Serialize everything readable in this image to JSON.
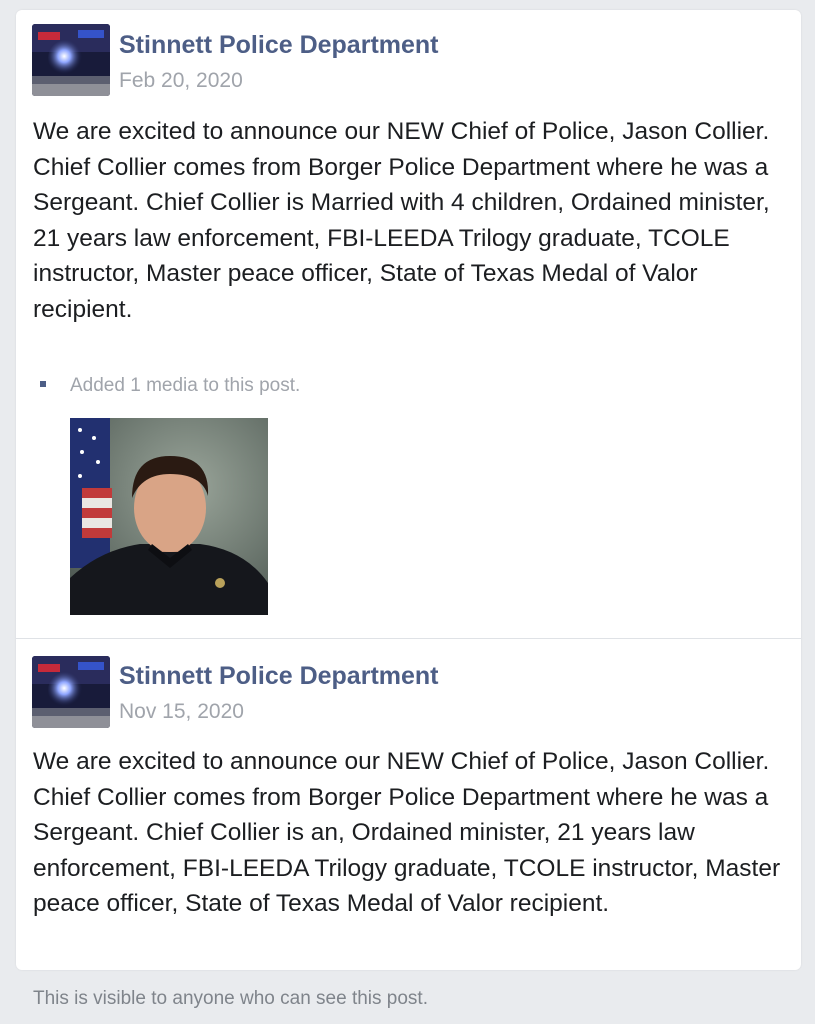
{
  "posts": [
    {
      "page_name": "Stinnett Police Department",
      "date": "Feb 20, 2020",
      "body": "We are excited to announce our NEW Chief of Police, Jason Collier. Chief Collier comes from Borger Police Department where he was a Sergeant. Chief Collier is Married with 4 children, Ordained minister, 21 years law enforcement, FBI-LEEDA Trilogy graduate, TCOLE instructor, Master peace officer, State of Texas Medal of Valor recipient.",
      "media_note": "Added 1 media to this post."
    },
    {
      "page_name": "Stinnett Police Department",
      "date": "Nov 15, 2020",
      "body": "We are excited to announce our NEW Chief of Police, Jason Collier. Chief Collier comes from Borger Police Department where he was a Sergeant. Chief Collier is an, Ordained minister, 21 years law enforcement, FBI-LEEDA Trilogy graduate, TCOLE instructor, Master peace officer, State of Texas Medal of Valor recipient."
    }
  ],
  "footer": {
    "visibility_note": "This is visible to anyone who can see this post."
  },
  "colors": {
    "page_name": "#4d5e86",
    "meta_text": "#a0a4ab",
    "body_text": "#1c1e21",
    "background": "#e9ebee"
  }
}
